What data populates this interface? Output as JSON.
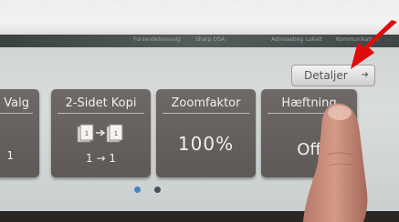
{
  "status_bar": {
    "items": [
      "Forsendelsesvalg",
      "Sharp OSA",
      "Adressebog",
      "Lokalt",
      "Kommunikation"
    ]
  },
  "detail_button": {
    "label": "Detaljer",
    "arrow": "➜"
  },
  "tiles": [
    {
      "title": "Valg",
      "value": "1"
    },
    {
      "title": "2-Sidet Kopi",
      "value": "1 → 1"
    },
    {
      "title": "Zoomfaktor",
      "value": "100%"
    },
    {
      "title": "Hæftning",
      "value": "Off"
    }
  ],
  "pager": {
    "pages": 2,
    "current": 1
  },
  "colors": {
    "tile": "#625d5b",
    "screen": "#d3d7d6",
    "arrow": "#e10b0b",
    "dot_active": "#3f86c9",
    "dot_inactive": "#45515b"
  }
}
